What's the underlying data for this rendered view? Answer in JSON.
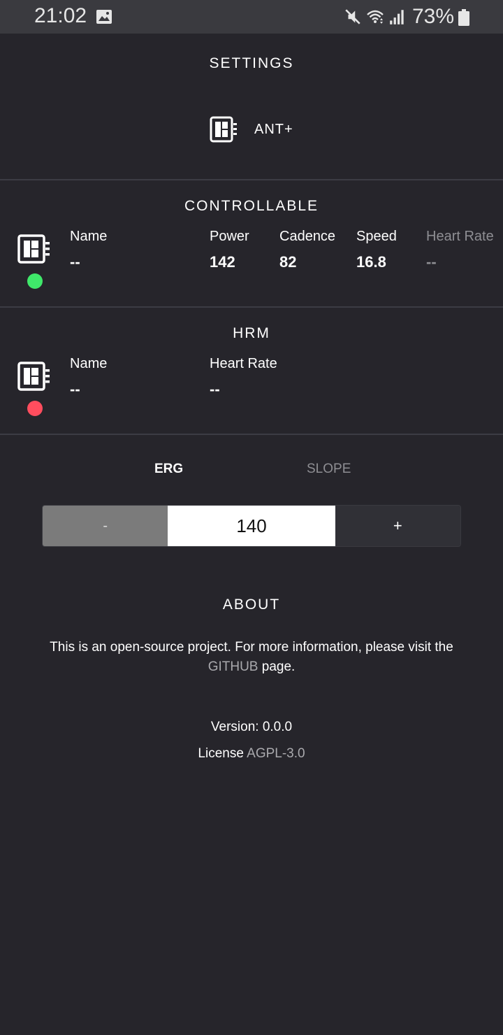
{
  "status_bar": {
    "time": "21:02",
    "battery_text": "73%",
    "icons": [
      "gallery-icon",
      "mute-icon",
      "wifi-icon",
      "signal-icon",
      "battery-icon"
    ]
  },
  "settings": {
    "title": "SETTINGS",
    "ant_label": "ANT+"
  },
  "controllable": {
    "title": "CONTROLLABLE",
    "status_color": "#3fe86a",
    "fields": [
      {
        "label": "Name",
        "value": "--"
      },
      {
        "label": "Power",
        "value": "142"
      },
      {
        "label": "Cadence",
        "value": "82"
      },
      {
        "label": "Speed",
        "value": "16.8"
      },
      {
        "label": "Heart Rate",
        "value": "--"
      }
    ]
  },
  "hrm": {
    "title": "HRM",
    "status_color": "#ff4d5e",
    "fields": [
      {
        "label": "Name",
        "value": "--"
      },
      {
        "label": "Heart Rate",
        "value": "--"
      }
    ]
  },
  "mode": {
    "tabs": [
      {
        "label": "ERG",
        "active": true
      },
      {
        "label": "SLOPE",
        "active": false
      }
    ]
  },
  "stepper": {
    "minus_label": "-",
    "value": "140",
    "plus_label": "+"
  },
  "about": {
    "title": "ABOUT",
    "text_before": "This is an open-source project. For more information, please visit the",
    "link_label": "GITHUB",
    "text_after": " page.",
    "version_label": "Version: 0.0.0",
    "license_prefix": "License ",
    "license_value": "AGPL-3.0"
  },
  "colors": {
    "background": "#26252b",
    "status_bar": "#3a3a3f",
    "divider": "#3c3c44",
    "muted_text": "#8e8e93"
  }
}
